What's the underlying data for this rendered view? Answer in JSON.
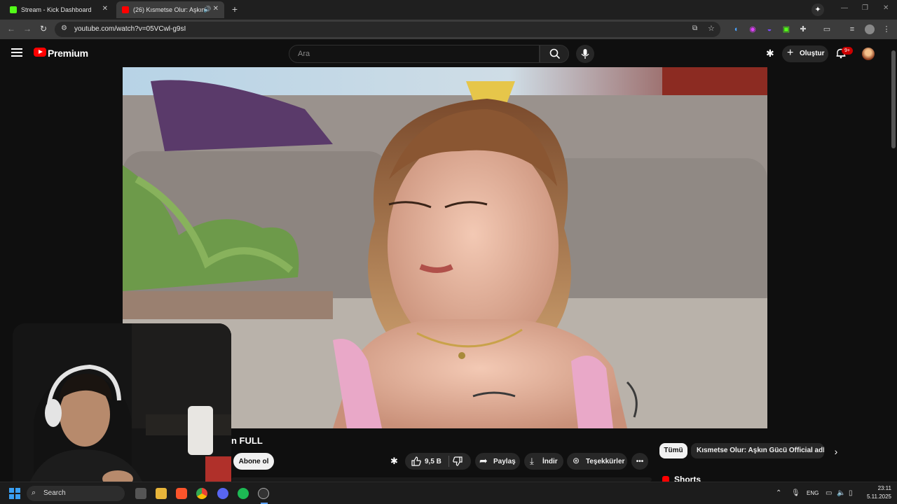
{
  "browser": {
    "tabs": [
      {
        "title": "Stream - Kick Dashboard",
        "favicon_color": "#53fc18"
      },
      {
        "title": "(26) Kısmetse Olur: Aşkın G",
        "favicon_color": "#ff0000"
      }
    ],
    "url": "youtube.com/watch?v=05VCwl-g9sI"
  },
  "youtube": {
    "brand": "Premium",
    "search_placeholder": "Ara",
    "create_label": "Oluştur",
    "notification_count": "9+"
  },
  "video": {
    "title_visible": "n FULL",
    "subscribe_label": "Abone ol",
    "like_count": "9,5 B",
    "share_label": "Paylaş",
    "download_label": "İndir",
    "thanks_label": "Teşekkürler"
  },
  "sidebar": {
    "chips": [
      {
        "label": "Tümü"
      },
      {
        "label": "Kısmetse Olur: Aşkın Gücü Official adlı yük"
      }
    ],
    "section_title": "Shorts"
  },
  "taskbar": {
    "search_label": "Search",
    "language": "ENG",
    "time": "23:11",
    "date": "5.11.2025"
  }
}
